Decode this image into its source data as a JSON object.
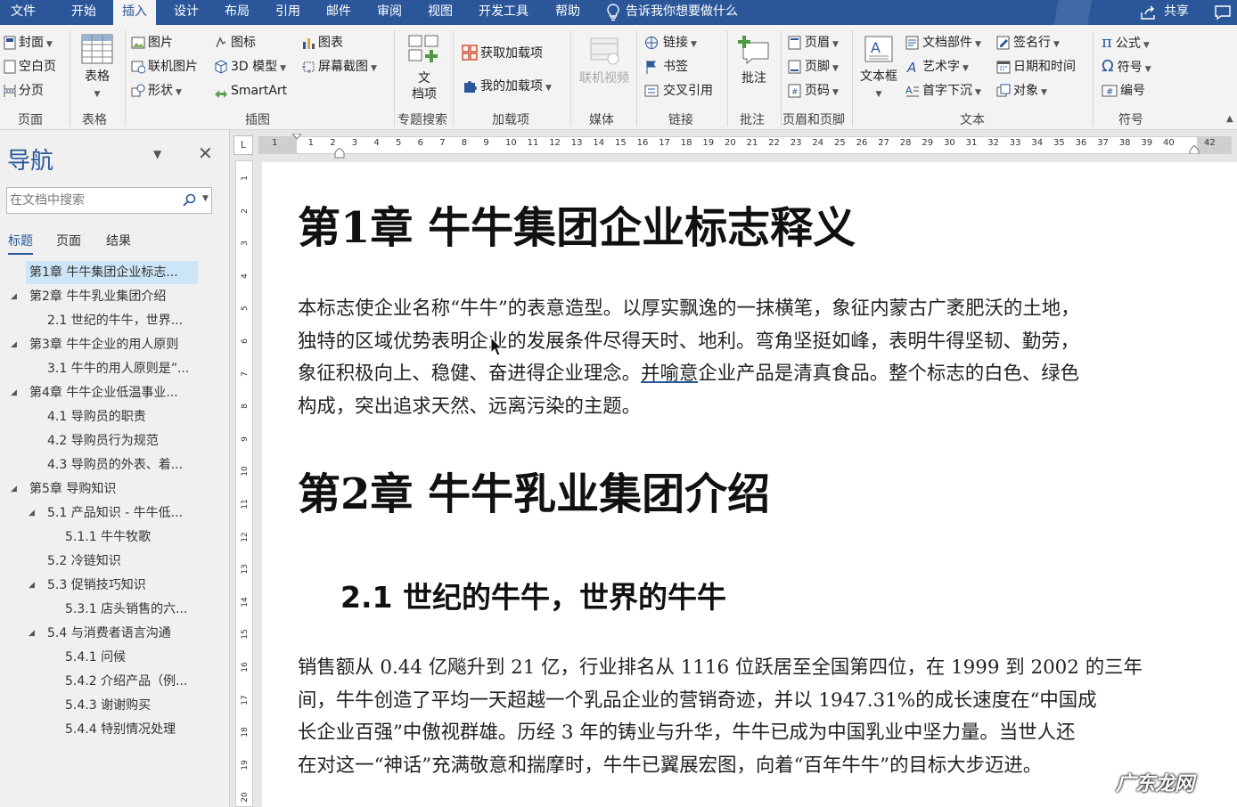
{
  "menu": {
    "tabs": [
      "文件",
      "开始",
      "插入",
      "设计",
      "布局",
      "引用",
      "邮件",
      "审阅",
      "视图",
      "开发工具",
      "帮助"
    ],
    "active": "插入",
    "tell_me": "告诉我你想要做什么",
    "share": "共享"
  },
  "ribbon": {
    "pages": {
      "cover": "封面",
      "blank": "空白页",
      "break": "分页",
      "label": "页面"
    },
    "tables": {
      "table": "表格",
      "label": "表格"
    },
    "illustrations": {
      "picture": "图片",
      "online_picture": "联机图片",
      "shapes": "形状",
      "icons": "图标",
      "model3d": "3D 模型",
      "smartart": "SmartArt",
      "chart": "图表",
      "screenshot": "屏幕截图",
      "label": "插图"
    },
    "search": {
      "doc_item_1": "文",
      "doc_item_2": "档项",
      "label": "专题搜索"
    },
    "addins": {
      "get": "获取加载项",
      "mine": "我的加载项",
      "label": "加载项"
    },
    "media": {
      "video": "联机视频",
      "label": "媒体"
    },
    "links": {
      "link": "链接",
      "bookmark": "书签",
      "cross_ref": "交叉引用",
      "label": "链接"
    },
    "comments": {
      "comment": "批注",
      "label": "批注"
    },
    "header_footer": {
      "header": "页眉",
      "footer": "页脚",
      "page_number": "页码",
      "label": "页眉和页脚"
    },
    "text": {
      "textbox": "文本框",
      "quick_parts": "文档部件",
      "wordart": "艺术字",
      "drop_cap": "首字下沉",
      "signature": "签名行",
      "datetime": "日期和时间",
      "object": "对象",
      "label": "文本"
    },
    "symbols": {
      "equation": "公式",
      "symbol": "符号",
      "number": "编号",
      "label": "符号"
    }
  },
  "nav": {
    "title": "导航",
    "search_placeholder": "在文档中搜索",
    "tabs": [
      "标题",
      "页面",
      "结果"
    ],
    "items": [
      {
        "text": "第1章 牛牛集团企业标志...",
        "level": 0,
        "selected": true,
        "expand": false
      },
      {
        "text": "第2章 牛牛乳业集团介绍",
        "level": 0,
        "expand": true
      },
      {
        "text": "2.1 世纪的牛牛，世界...",
        "level": 1,
        "expand": false
      },
      {
        "text": "第3章 牛牛企业的用人原则",
        "level": 0,
        "expand": true
      },
      {
        "text": "3.1 牛牛的用人原则是”...",
        "level": 1,
        "expand": false
      },
      {
        "text": "第4章 牛牛企业低温事业...",
        "level": 0,
        "expand": true
      },
      {
        "text": "4.1 导购员的职责",
        "level": 1,
        "expand": false
      },
      {
        "text": "4.2 导购员行为规范",
        "level": 1,
        "expand": false
      },
      {
        "text": "4.3 导购员的外表、着...",
        "level": 1,
        "expand": false
      },
      {
        "text": "第5章 导购知识",
        "level": 0,
        "expand": true
      },
      {
        "text": "5.1 产品知识 - 牛牛低...",
        "level": 1,
        "expand": true
      },
      {
        "text": "5.1.1 牛牛牧歌",
        "level": 2,
        "expand": false
      },
      {
        "text": "5.2 冷链知识",
        "level": 1,
        "expand": false
      },
      {
        "text": "5.3 促销技巧知识",
        "level": 1,
        "expand": true
      },
      {
        "text": "5.3.1 店头销售的六...",
        "level": 2,
        "expand": false
      },
      {
        "text": "5.4 与消费者语言沟通",
        "level": 1,
        "expand": true
      },
      {
        "text": "5.4.1 问候",
        "level": 2,
        "expand": false
      },
      {
        "text": "5.4.2 介绍产品（例...",
        "level": 2,
        "expand": false
      },
      {
        "text": "5.4.3 谢谢购买",
        "level": 2,
        "expand": false
      },
      {
        "text": "5.4.4 特别情况处理",
        "level": 2,
        "expand": false
      }
    ]
  },
  "ruler": {
    "corner": "L",
    "ticks": [
      "1",
      "1",
      "2",
      "3",
      "4",
      "5",
      "6",
      "7",
      "8",
      "9",
      "10",
      "11",
      "12",
      "13",
      "14",
      "15",
      "16",
      "17",
      "18",
      "19",
      "20",
      "21",
      "22",
      "23",
      "24",
      "25",
      "26",
      "27",
      "28",
      "29",
      "30",
      "31",
      "32",
      "33",
      "34",
      "35",
      "36",
      "37",
      "38",
      "39",
      "40",
      "42"
    ],
    "vticks": [
      "1",
      "2",
      "3",
      "4",
      "5",
      "6",
      "7",
      "8",
      "9",
      "10",
      "11",
      "12",
      "13",
      "14",
      "15",
      "16",
      "17",
      "18",
      "19",
      "20"
    ]
  },
  "document": {
    "ch1_title": "第1章  牛牛集团企业标志释义",
    "p1": [
      "本标志使企业名称“牛牛”的表意造型。以厚实飘逸的一抹横笔，象征内蒙古广袤肥沃的土地，",
      "独特的区域优势表明企业的发展条件尽得天时、地利。弯角坚挺如峰，表明牛得坚韧、勤劳，",
      "象征积极向上、稳健、奋进得企业理念。",
      "并喻意",
      "企业产品是清真食品。整个标志的白色、绿色",
      "构成，突出追求天然、远离污染的主题。"
    ],
    "ch2_title": "第2章  牛牛乳业集团介绍",
    "sec21_title": "2.1 世纪的牛牛，世界的牛牛",
    "p2": [
      "销售额从 0.44 亿飚升到 21 亿，行业排名从 1116 位跃居至全国第四位，在 1999 到 2002 的三年",
      "间，牛牛创造了平均一天超越一个乳品企业的营销奇迹，并以 1947.31%的成长速度在“中国成",
      "长企业百强”中傲视群雄。历经 3 年的铸业与升华，牛牛已成为中国乳业中坚力量。当世人还",
      "在对这一“神话”充满敬意和揣摩时，牛牛已翼展宏图，向着“百年牛牛”的目标大步迈进。"
    ]
  },
  "watermark": "广东龙网"
}
